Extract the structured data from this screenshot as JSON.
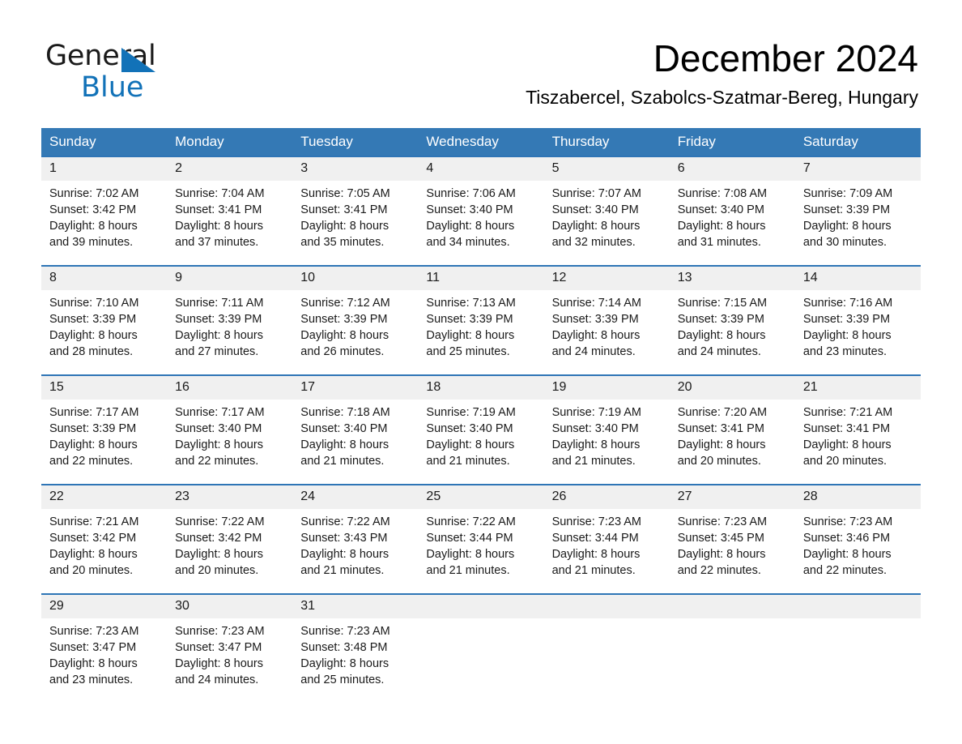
{
  "logo": {
    "word1": "General",
    "word2": "Blue",
    "triangle_color": "#1272b8",
    "icon": "triangle-icon"
  },
  "header": {
    "title": "December 2024",
    "subtitle": "Tiszabercel, Szabolcs-Szatmar-Bereg, Hungary"
  },
  "theme": {
    "header_blue": "#3479b5",
    "rule_blue": "#2e75b6",
    "daynum_band": "#f0f0f0"
  },
  "weekday_headers": [
    "Sunday",
    "Monday",
    "Tuesday",
    "Wednesday",
    "Thursday",
    "Friday",
    "Saturday"
  ],
  "weeks": [
    [
      {
        "day": "1",
        "sunrise": "Sunrise: 7:02 AM",
        "sunset": "Sunset: 3:42 PM",
        "daylight1": "Daylight: 8 hours",
        "daylight2": "and 39 minutes."
      },
      {
        "day": "2",
        "sunrise": "Sunrise: 7:04 AM",
        "sunset": "Sunset: 3:41 PM",
        "daylight1": "Daylight: 8 hours",
        "daylight2": "and 37 minutes."
      },
      {
        "day": "3",
        "sunrise": "Sunrise: 7:05 AM",
        "sunset": "Sunset: 3:41 PM",
        "daylight1": "Daylight: 8 hours",
        "daylight2": "and 35 minutes."
      },
      {
        "day": "4",
        "sunrise": "Sunrise: 7:06 AM",
        "sunset": "Sunset: 3:40 PM",
        "daylight1": "Daylight: 8 hours",
        "daylight2": "and 34 minutes."
      },
      {
        "day": "5",
        "sunrise": "Sunrise: 7:07 AM",
        "sunset": "Sunset: 3:40 PM",
        "daylight1": "Daylight: 8 hours",
        "daylight2": "and 32 minutes."
      },
      {
        "day": "6",
        "sunrise": "Sunrise: 7:08 AM",
        "sunset": "Sunset: 3:40 PM",
        "daylight1": "Daylight: 8 hours",
        "daylight2": "and 31 minutes."
      },
      {
        "day": "7",
        "sunrise": "Sunrise: 7:09 AM",
        "sunset": "Sunset: 3:39 PM",
        "daylight1": "Daylight: 8 hours",
        "daylight2": "and 30 minutes."
      }
    ],
    [
      {
        "day": "8",
        "sunrise": "Sunrise: 7:10 AM",
        "sunset": "Sunset: 3:39 PM",
        "daylight1": "Daylight: 8 hours",
        "daylight2": "and 28 minutes."
      },
      {
        "day": "9",
        "sunrise": "Sunrise: 7:11 AM",
        "sunset": "Sunset: 3:39 PM",
        "daylight1": "Daylight: 8 hours",
        "daylight2": "and 27 minutes."
      },
      {
        "day": "10",
        "sunrise": "Sunrise: 7:12 AM",
        "sunset": "Sunset: 3:39 PM",
        "daylight1": "Daylight: 8 hours",
        "daylight2": "and 26 minutes."
      },
      {
        "day": "11",
        "sunrise": "Sunrise: 7:13 AM",
        "sunset": "Sunset: 3:39 PM",
        "daylight1": "Daylight: 8 hours",
        "daylight2": "and 25 minutes."
      },
      {
        "day": "12",
        "sunrise": "Sunrise: 7:14 AM",
        "sunset": "Sunset: 3:39 PM",
        "daylight1": "Daylight: 8 hours",
        "daylight2": "and 24 minutes."
      },
      {
        "day": "13",
        "sunrise": "Sunrise: 7:15 AM",
        "sunset": "Sunset: 3:39 PM",
        "daylight1": "Daylight: 8 hours",
        "daylight2": "and 24 minutes."
      },
      {
        "day": "14",
        "sunrise": "Sunrise: 7:16 AM",
        "sunset": "Sunset: 3:39 PM",
        "daylight1": "Daylight: 8 hours",
        "daylight2": "and 23 minutes."
      }
    ],
    [
      {
        "day": "15",
        "sunrise": "Sunrise: 7:17 AM",
        "sunset": "Sunset: 3:39 PM",
        "daylight1": "Daylight: 8 hours",
        "daylight2": "and 22 minutes."
      },
      {
        "day": "16",
        "sunrise": "Sunrise: 7:17 AM",
        "sunset": "Sunset: 3:40 PM",
        "daylight1": "Daylight: 8 hours",
        "daylight2": "and 22 minutes."
      },
      {
        "day": "17",
        "sunrise": "Sunrise: 7:18 AM",
        "sunset": "Sunset: 3:40 PM",
        "daylight1": "Daylight: 8 hours",
        "daylight2": "and 21 minutes."
      },
      {
        "day": "18",
        "sunrise": "Sunrise: 7:19 AM",
        "sunset": "Sunset: 3:40 PM",
        "daylight1": "Daylight: 8 hours",
        "daylight2": "and 21 minutes."
      },
      {
        "day": "19",
        "sunrise": "Sunrise: 7:19 AM",
        "sunset": "Sunset: 3:40 PM",
        "daylight1": "Daylight: 8 hours",
        "daylight2": "and 21 minutes."
      },
      {
        "day": "20",
        "sunrise": "Sunrise: 7:20 AM",
        "sunset": "Sunset: 3:41 PM",
        "daylight1": "Daylight: 8 hours",
        "daylight2": "and 20 minutes."
      },
      {
        "day": "21",
        "sunrise": "Sunrise: 7:21 AM",
        "sunset": "Sunset: 3:41 PM",
        "daylight1": "Daylight: 8 hours",
        "daylight2": "and 20 minutes."
      }
    ],
    [
      {
        "day": "22",
        "sunrise": "Sunrise: 7:21 AM",
        "sunset": "Sunset: 3:42 PM",
        "daylight1": "Daylight: 8 hours",
        "daylight2": "and 20 minutes."
      },
      {
        "day": "23",
        "sunrise": "Sunrise: 7:22 AM",
        "sunset": "Sunset: 3:42 PM",
        "daylight1": "Daylight: 8 hours",
        "daylight2": "and 20 minutes."
      },
      {
        "day": "24",
        "sunrise": "Sunrise: 7:22 AM",
        "sunset": "Sunset: 3:43 PM",
        "daylight1": "Daylight: 8 hours",
        "daylight2": "and 21 minutes."
      },
      {
        "day": "25",
        "sunrise": "Sunrise: 7:22 AM",
        "sunset": "Sunset: 3:44 PM",
        "daylight1": "Daylight: 8 hours",
        "daylight2": "and 21 minutes."
      },
      {
        "day": "26",
        "sunrise": "Sunrise: 7:23 AM",
        "sunset": "Sunset: 3:44 PM",
        "daylight1": "Daylight: 8 hours",
        "daylight2": "and 21 minutes."
      },
      {
        "day": "27",
        "sunrise": "Sunrise: 7:23 AM",
        "sunset": "Sunset: 3:45 PM",
        "daylight1": "Daylight: 8 hours",
        "daylight2": "and 22 minutes."
      },
      {
        "day": "28",
        "sunrise": "Sunrise: 7:23 AM",
        "sunset": "Sunset: 3:46 PM",
        "daylight1": "Daylight: 8 hours",
        "daylight2": "and 22 minutes."
      }
    ],
    [
      {
        "day": "29",
        "sunrise": "Sunrise: 7:23 AM",
        "sunset": "Sunset: 3:47 PM",
        "daylight1": "Daylight: 8 hours",
        "daylight2": "and 23 minutes."
      },
      {
        "day": "30",
        "sunrise": "Sunrise: 7:23 AM",
        "sunset": "Sunset: 3:47 PM",
        "daylight1": "Daylight: 8 hours",
        "daylight2": "and 24 minutes."
      },
      {
        "day": "31",
        "sunrise": "Sunrise: 7:23 AM",
        "sunset": "Sunset: 3:48 PM",
        "daylight1": "Daylight: 8 hours",
        "daylight2": "and 25 minutes."
      },
      {
        "day": "",
        "sunrise": "",
        "sunset": "",
        "daylight1": "",
        "daylight2": ""
      },
      {
        "day": "",
        "sunrise": "",
        "sunset": "",
        "daylight1": "",
        "daylight2": ""
      },
      {
        "day": "",
        "sunrise": "",
        "sunset": "",
        "daylight1": "",
        "daylight2": ""
      },
      {
        "day": "",
        "sunrise": "",
        "sunset": "",
        "daylight1": "",
        "daylight2": ""
      }
    ]
  ]
}
